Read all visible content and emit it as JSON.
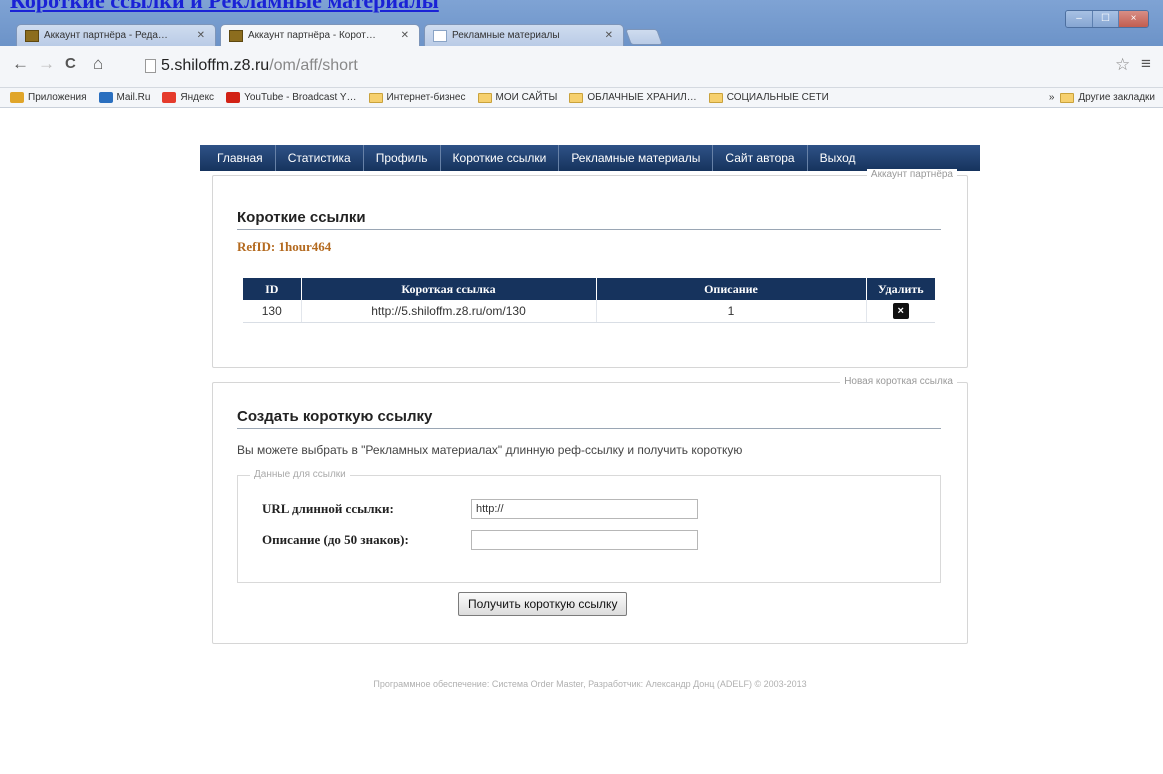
{
  "page_heading": "Короткие ссылки и Рекламные материалы",
  "window": {
    "controls": [
      "–",
      "☐",
      "×"
    ]
  },
  "tabs": [
    {
      "label": "Аккаунт партнёра - Реда…",
      "active": false,
      "icon": "site-favicon"
    },
    {
      "label": "Аккаунт партнёра - Корот…",
      "active": true,
      "icon": "site-favicon"
    },
    {
      "label": "Рекламные материалы",
      "active": false,
      "icon": "page-icon"
    }
  ],
  "toolbar": {
    "back": "←",
    "forward": "→",
    "reload": "C",
    "home": "⌂",
    "url_host": "5.shiloffm.z8.ru",
    "url_path": "/om/aff/short",
    "star": "☆",
    "menu": "≡"
  },
  "bookmarks": {
    "items": [
      {
        "label": "Приложения",
        "icon": "apps-icon",
        "color": "#e0a52a"
      },
      {
        "label": "Mail.Ru",
        "icon": "mailru-icon",
        "color": "#2a6fbf"
      },
      {
        "label": "Яндекс",
        "icon": "yandex-icon",
        "color": "#e53b2c"
      },
      {
        "label": "YouTube - Broadcast Y…",
        "icon": "youtube-icon",
        "color": "#d22215"
      },
      {
        "label": "Интернет-бизнес",
        "icon": "folder-icon",
        "color": ""
      },
      {
        "label": "МОИ САЙТЫ",
        "icon": "folder-icon",
        "color": ""
      },
      {
        "label": "ОБЛАЧНЫЕ ХРАНИЛ…",
        "icon": "folder-icon",
        "color": ""
      },
      {
        "label": "СОЦИАЛЬНЫЕ СЕТИ",
        "icon": "folder-icon",
        "color": ""
      }
    ],
    "overflow": "»",
    "other": "Другие закладки"
  },
  "nav": {
    "items": [
      "Главная",
      "Статистика",
      "Профиль",
      "Короткие ссылки",
      "Рекламные материалы",
      "Сайт автора",
      "Выход"
    ]
  },
  "account_panel": {
    "legend": "Аккаунт партнёра",
    "title": "Короткие ссылки",
    "refid_label": "RefID:",
    "refid_value": "1hour464",
    "table": {
      "headers": [
        "ID",
        "Короткая ссылка",
        "Описание",
        "Удалить"
      ],
      "rows": [
        {
          "id": "130",
          "link": "http://5.shiloffm.z8.ru/om/130",
          "description": "1",
          "delete": "×"
        }
      ]
    }
  },
  "create_panel": {
    "legend": "Новая короткая ссылка",
    "title": "Создать короткую ссылку",
    "description": "Вы можете выбрать в \"Рекламных материалах\" длинную реф-ссылку и получить короткую",
    "fieldset_legend": "Данные для ссылки",
    "url_label": "URL длинной ссылки:",
    "url_value": "http://",
    "desc_label": "Описание (до 50 знаков):",
    "desc_value": "",
    "submit": "Получить короткую ссылку"
  },
  "footer": "Программное обеспечение: Система Order Master, Разработчик: Александр Донц (ADELF) © 2003-2013",
  "colors": {
    "nav_bg": "#16335d",
    "accent_orange": "#b46a1f",
    "heading_link": "#1a22d6",
    "titlebar": "#6c93c8"
  }
}
